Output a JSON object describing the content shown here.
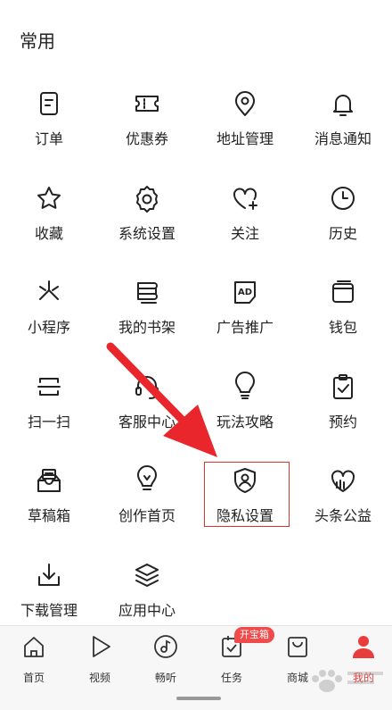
{
  "section_title": "常用",
  "items": [
    {
      "label": "订单",
      "icon": "order-icon"
    },
    {
      "label": "优惠券",
      "icon": "coupon-icon"
    },
    {
      "label": "地址管理",
      "icon": "location-pin-icon"
    },
    {
      "label": "消息通知",
      "icon": "bell-icon"
    },
    {
      "label": "收藏",
      "icon": "star-icon"
    },
    {
      "label": "系统设置",
      "icon": "gear-icon"
    },
    {
      "label": "关注",
      "icon": "heart-plus-icon"
    },
    {
      "label": "历史",
      "icon": "clock-icon"
    },
    {
      "label": "小程序",
      "icon": "mini-program-icon"
    },
    {
      "label": "我的书架",
      "icon": "bookshelf-icon"
    },
    {
      "label": "广告推广",
      "icon": "ad-icon"
    },
    {
      "label": "钱包",
      "icon": "wallet-icon"
    },
    {
      "label": "扫一扫",
      "icon": "scan-icon"
    },
    {
      "label": "客服中心",
      "icon": "headset-icon"
    },
    {
      "label": "玩法攻略",
      "icon": "lightbulb-icon"
    },
    {
      "label": "预约",
      "icon": "clipboard-check-icon"
    },
    {
      "label": "草稿箱",
      "icon": "draft-box-icon"
    },
    {
      "label": "创作首页",
      "icon": "creation-bulb-icon"
    },
    {
      "label": "隐私设置",
      "icon": "privacy-shield-icon"
    },
    {
      "label": "头条公益",
      "icon": "charity-heart-icon"
    },
    {
      "label": "下载管理",
      "icon": "download-icon"
    },
    {
      "label": "应用中心",
      "icon": "layers-icon"
    }
  ],
  "tabs": [
    {
      "label": "首页",
      "icon": "home-icon",
      "active": false
    },
    {
      "label": "视频",
      "icon": "play-icon",
      "active": false
    },
    {
      "label": "畅听",
      "icon": "music-disc-icon",
      "active": false
    },
    {
      "label": "任务",
      "icon": "task-check-icon",
      "active": false
    },
    {
      "label": "商城",
      "icon": "shopping-bag-icon",
      "active": false
    },
    {
      "label": "我的",
      "icon": "user-icon",
      "active": true
    }
  ],
  "task_badge": "开宝箱",
  "colors": {
    "accent": "#e93c3c",
    "arrow": "#e8262b",
    "highlight_border": "#d9342b"
  }
}
